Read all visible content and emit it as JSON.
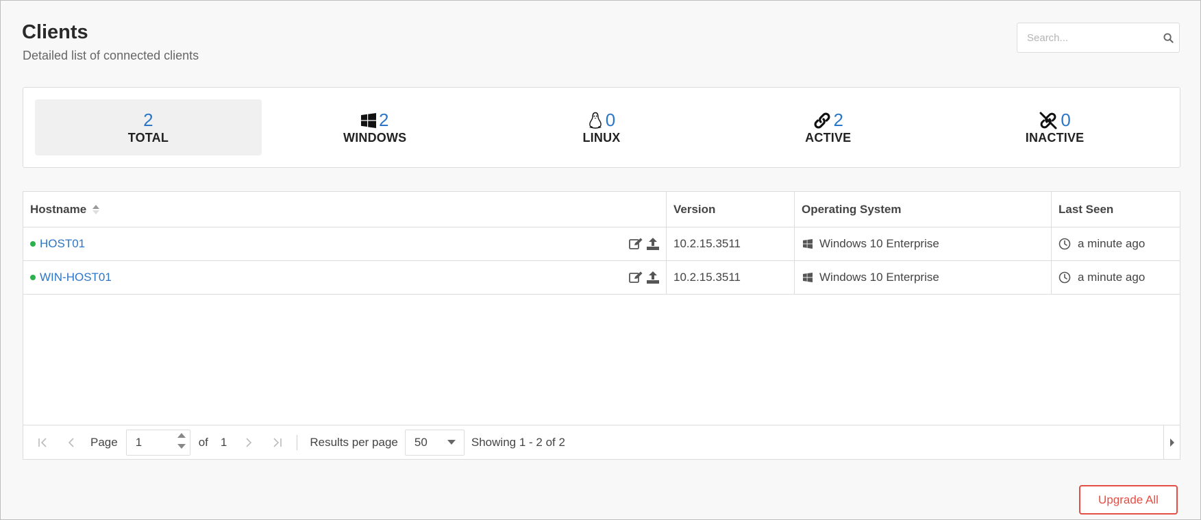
{
  "header": {
    "title": "Clients",
    "subtitle": "Detailed list of connected clients"
  },
  "search": {
    "placeholder": "Search...",
    "value": "",
    "icon": "search-icon"
  },
  "stats": [
    {
      "value": "2",
      "label": "TOTAL",
      "icon": "",
      "selected": true
    },
    {
      "value": "2",
      "label": "WINDOWS",
      "icon": "windows-icon"
    },
    {
      "value": "0",
      "label": "LINUX",
      "icon": "linux-icon"
    },
    {
      "value": "2",
      "label": "ACTIVE",
      "icon": "link-icon"
    },
    {
      "value": "0",
      "label": "INACTIVE",
      "icon": "unlink-icon"
    }
  ],
  "table": {
    "columns": [
      "Hostname",
      "Version",
      "Operating System",
      "Last Seen"
    ],
    "sort": {
      "column": "Hostname",
      "direction": "ascending"
    },
    "rows": [
      {
        "hostname": "HOST01",
        "status": "online",
        "version": "10.2.15.3511",
        "os": "Windows 10 Enterprise",
        "last_seen": "a minute ago"
      },
      {
        "hostname": "WIN-HOST01",
        "status": "online",
        "version": "10.2.15.3511",
        "os": "Windows 10 Enterprise",
        "last_seen": "a minute ago"
      }
    ]
  },
  "pager": {
    "page_label": "Page",
    "page_value": "1",
    "of_label": "of",
    "total_pages": "1",
    "rpp_label": "Results per page",
    "rpp_value": "50",
    "showing": "Showing 1 - 2 of 2"
  },
  "actions": {
    "upgrade_all": "Upgrade All"
  },
  "colors": {
    "accent": "#2c76c7",
    "online": "#2bb24c",
    "danger": "#e44e45"
  }
}
